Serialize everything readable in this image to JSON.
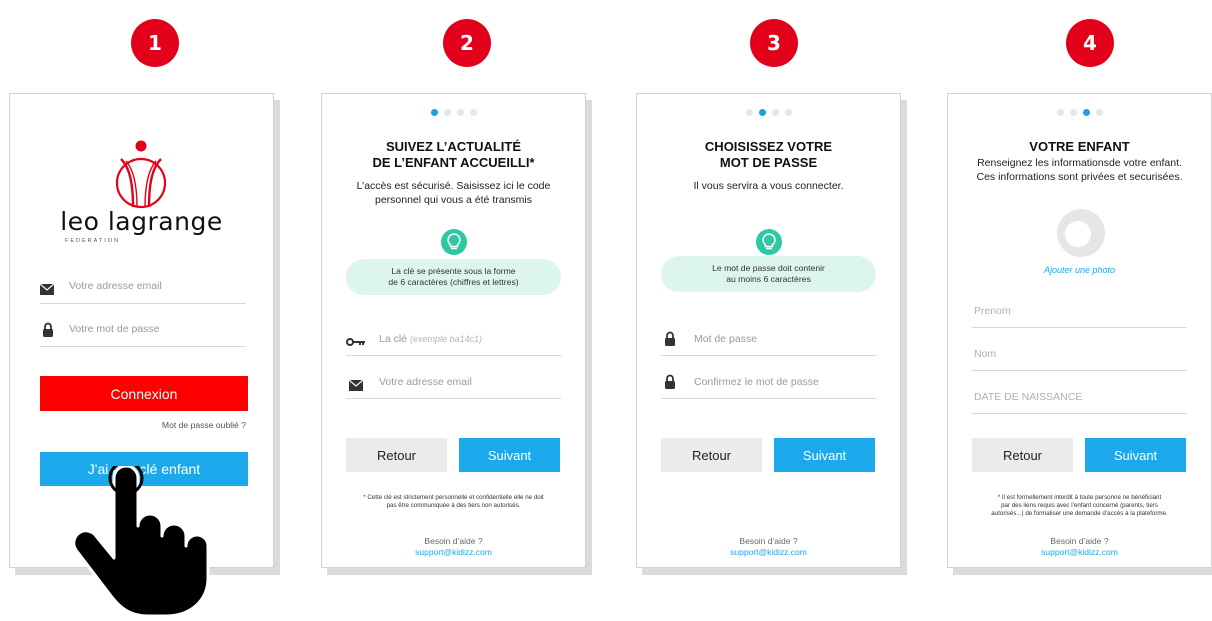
{
  "steps": [
    "1",
    "2",
    "3",
    "4"
  ],
  "colors": {
    "brand_red": "#e2001a",
    "accent_blue": "#1ba9ec",
    "tip_green": "#2ec9a4"
  },
  "login": {
    "logo_text": "leo lagrange",
    "logo_sub": "FEDERATION",
    "email_placeholder": "Votre adresse email",
    "password_placeholder": "Votre mot de passe",
    "connect_label": "Connexion",
    "forgot_label": "Mot de passe oublié ?",
    "child_key_label": "J'ai une clé enfant"
  },
  "step2": {
    "title_line1": "SUIVEZ L’ACTUALITÉ",
    "title_line2": "DE L’ENFANT ACCUEILLI*",
    "sub_line1": "L’accès est sécurisé. Saisissez ici le code",
    "sub_line2": "personnel qui vous a été transmis",
    "tip_line1": "La clé se présente sous la forme",
    "tip_line2": "de 6 caractères (chiffres et lettres)",
    "key_placeholder": "La clé",
    "key_example": "(exemple ba14c1)",
    "email_placeholder": "Votre adresse email",
    "back_label": "Retour",
    "next_label": "Suivant",
    "note_line1": "* Cette clé est strictement personnelle et confidentielle elle ne doit",
    "note_line2": "pas être communiquée à des tiers non autorisés.",
    "help_label": "Besoin d’aide ?",
    "help_email": "support@kidizz.com"
  },
  "step3": {
    "title_line1": "CHOISISSEZ VOTRE",
    "title_line2": "MOT DE PASSE",
    "sub_line1": "Il vous servira a vous connecter.",
    "tip_line1": "Le mot de passe doit contenir",
    "tip_line2": "au moins 6 caractères",
    "password_placeholder": "Mot de passe",
    "confirm_placeholder": "Confirmez le mot de passe",
    "back_label": "Retour",
    "next_label": "Suivant",
    "help_label": "Besoin d’aide ?",
    "help_email": "support@kidizz.com"
  },
  "step4": {
    "title_line1": "VOTRE ENFANT",
    "sub_line1": "Renseignez les informationsde votre enfant.",
    "sub_line2": "Ces informations sont privées et securisées.",
    "add_photo_label": "Ajouter une photo",
    "firstname_placeholder": "Prenom",
    "lastname_placeholder": "Nom",
    "birthdate_placeholder": "DATE DE NAISSANCE",
    "back_label": "Retour",
    "next_label": "Suivant",
    "note_line1": "* Il est formellement interdit à toute personne ne bénéficiant",
    "note_line2": "par des liens requis avec l’enfant concerné (parents, tiers",
    "note_line3": "autorisés...) de formaliser une demande d’accès à la plateforme.",
    "help_label": "Besoin d’aide ?",
    "help_email": "support@kidizz.com"
  }
}
